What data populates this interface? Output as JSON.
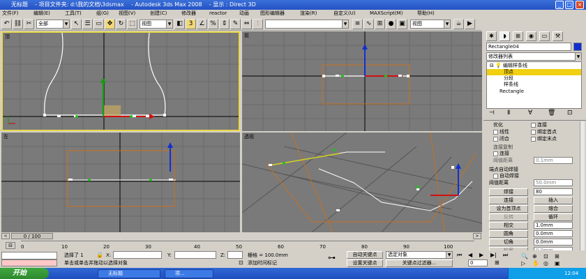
{
  "titlebar": {
    "text": "无标题    - 项目文件夹: d:\\我的文档\\3dsmax    - Autodesk 3ds Max 2008    - 显示 : Direct 3D",
    "min": "_",
    "max": "□",
    "close": "×"
  },
  "menu": [
    "文件(F)",
    "编辑(E)",
    "工具(T)",
    "组(G)",
    "视图(V)",
    "创建(C)",
    "修改器",
    "reactor",
    "动画",
    "图形编辑器",
    "渲染(R)",
    "自定义(U)",
    "MAXScript(M)",
    "帮助(H)"
  ],
  "toolbar": {
    "all_label": "全部",
    "view_label": "视图",
    "view_label2": "视图"
  },
  "viewports": {
    "top": "顶",
    "front": "前",
    "left": "左",
    "persp": "透视"
  },
  "panel": {
    "object_name": "Rectangle04",
    "modifier_list": "修改器列表",
    "stack": [
      "编辑样条线",
      "顶点",
      "分段",
      "样条线",
      "Rectangle"
    ],
    "opt_label": "优化",
    "connect": "连接",
    "linear": "线性",
    "bind_first": "绑定首点",
    "closed": "闭合",
    "bind_last": "绑定末点",
    "connect_copy": "连接复制",
    "connect2": "连接",
    "threshold": "阈值距离",
    "threshold_val": "0.1mm",
    "endpoint_weld": "端点自动焊接",
    "auto_weld": "自动焊接",
    "weld_threshold": "阈值距离",
    "weld_threshold_val": "50.0mm",
    "weld": "焊接",
    "weld_val": "80",
    "connect_btn": "连接",
    "insert_btn": "插入",
    "set_first": "设为首顶点",
    "fuse": "熔合",
    "reverse": "反转",
    "cycle": "循环",
    "cross": "相交",
    "cross_val": "1.0mm",
    "fillet": "圆角",
    "fillet_val": "0.0mm",
    "chamfer": "切角",
    "chamfer_val": "0.0mm",
    "outline": "轮廓",
    "outline_val": "0.0mm"
  },
  "timeline": {
    "frame": "0 / 100"
  },
  "ruler": [
    "0",
    "10",
    "20",
    "30",
    "40",
    "50",
    "60",
    "70",
    "80",
    "90",
    "100"
  ],
  "status": {
    "selected": "选择了 1",
    "x_label": "X:",
    "y_label": "Y:",
    "z_label": "Z:",
    "grid": "栅格 = 100.0mm",
    "auto_key": "自动关键点",
    "selected_obj": "选定对象",
    "set_key": "设置关键点",
    "key_filter": "关键点过滤器...",
    "hint": "单击或单击并拖动以选择对象",
    "add_time": "添加时间标记",
    "frame_val": "0"
  },
  "taskbar": {
    "start": "开始",
    "task1": "无标题",
    "task2": "项...",
    "clock": "12:04"
  }
}
